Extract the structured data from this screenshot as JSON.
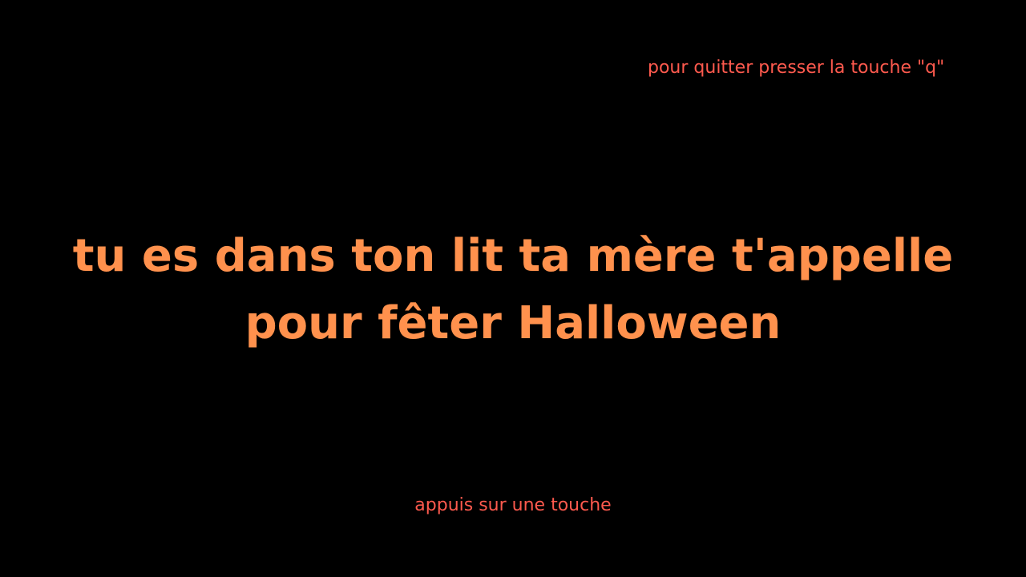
{
  "colors": {
    "background": "#000000",
    "story_text": "#ff914d",
    "hint_text": "#ff5a4e"
  },
  "quit_hint": "pour quitter presser la touche \"q\"",
  "story": {
    "lines": [
      "tu es dans ton lit ta mère t'appelle",
      "pour fêter Halloween"
    ]
  },
  "continue_hint": "appuis sur une touche"
}
